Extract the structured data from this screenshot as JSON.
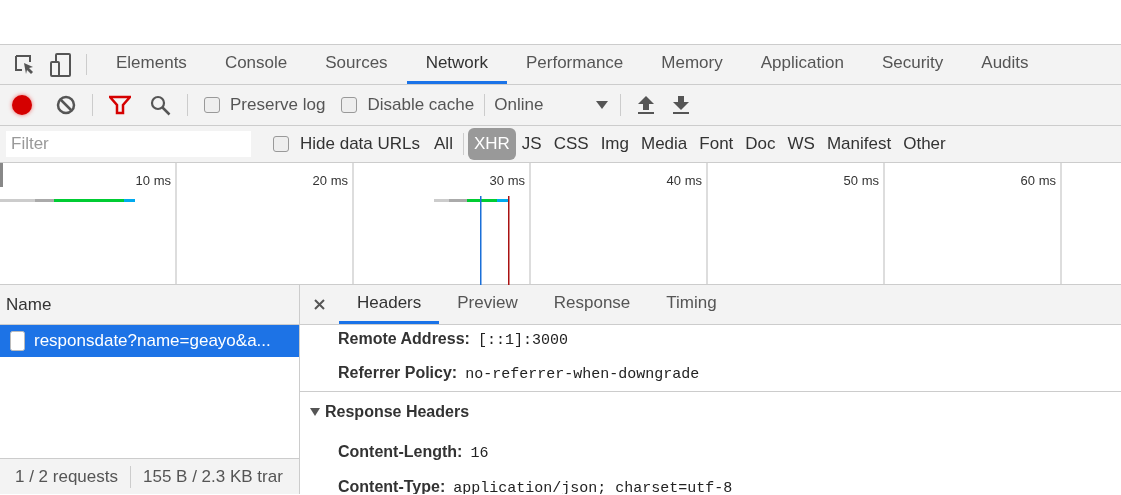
{
  "main_tabs": [
    {
      "label": "Elements",
      "selected": false
    },
    {
      "label": "Console",
      "selected": false
    },
    {
      "label": "Sources",
      "selected": false
    },
    {
      "label": "Network",
      "selected": true
    },
    {
      "label": "Performance",
      "selected": false
    },
    {
      "label": "Memory",
      "selected": false
    },
    {
      "label": "Application",
      "selected": false
    },
    {
      "label": "Security",
      "selected": false
    },
    {
      "label": "Audits",
      "selected": false
    }
  ],
  "toolbar": {
    "recording": true,
    "options": [
      {
        "label": "Preserve log",
        "checked": false
      },
      {
        "label": "Disable cache",
        "checked": false
      }
    ],
    "throttling": "Online"
  },
  "filter_bar": {
    "placeholder": "Filter",
    "hide_data_urls": {
      "label": "Hide data URLs",
      "checked": false
    },
    "types": [
      {
        "label": "All",
        "selected": false
      },
      {
        "label": "XHR",
        "selected": true
      },
      {
        "label": "JS",
        "selected": false
      },
      {
        "label": "CSS",
        "selected": false
      },
      {
        "label": "Img",
        "selected": false
      },
      {
        "label": "Media",
        "selected": false
      },
      {
        "label": "Font",
        "selected": false
      },
      {
        "label": "Doc",
        "selected": false
      },
      {
        "label": "WS",
        "selected": false
      },
      {
        "label": "Manifest",
        "selected": false
      },
      {
        "label": "Other",
        "selected": false
      }
    ]
  },
  "overview": {
    "ticks": [
      "10 ms",
      "20 ms",
      "30 ms",
      "40 ms",
      "50 ms",
      "60 ms"
    ]
  },
  "requests": {
    "column": "Name",
    "rows": [
      {
        "name": "responsdate?name=geayo&a...",
        "selected": true
      }
    ]
  },
  "status_bar": [
    "1 / 2 requests",
    "155 B / 2.3 KB trar"
  ],
  "detail": {
    "tabs": [
      {
        "label": "Headers",
        "selected": true
      },
      {
        "label": "Preview",
        "selected": false
      },
      {
        "label": "Response",
        "selected": false
      },
      {
        "label": "Timing",
        "selected": false
      }
    ],
    "general_rows": [
      {
        "key": "Remote Address:",
        "value": "[::1]:3000"
      },
      {
        "key": "Referrer Policy:",
        "value": "no-referrer-when-downgrade"
      }
    ],
    "sections": [
      {
        "title": "Response Headers",
        "expanded": true,
        "rows": [
          {
            "key": "Content-Length:",
            "value": "16"
          },
          {
            "key": "Content-Type:",
            "value": "application/json; charset=utf-8"
          }
        ]
      }
    ]
  }
}
